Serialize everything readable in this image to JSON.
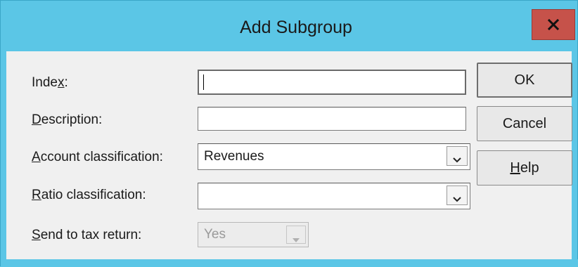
{
  "window": {
    "title": "Add Subgroup",
    "close_label": "x",
    "accent_color": "#5bc6e6",
    "close_color": "#c6524a"
  },
  "form": {
    "index": {
      "label_pre": "Inde",
      "label_key": "x",
      "label_post": ":",
      "value": ""
    },
    "description": {
      "label_pre": "",
      "label_key": "D",
      "label_post": "escription:",
      "value": ""
    },
    "account_classification": {
      "label_pre": "",
      "label_key": "A",
      "label_post": "ccount classification:",
      "value": "Revenues"
    },
    "ratio_classification": {
      "label_pre": "",
      "label_key": "R",
      "label_post": "atio classification:",
      "value": ""
    },
    "send_to_tax_return": {
      "label_pre": "",
      "label_key": "S",
      "label_post": "end to tax return:",
      "value": "Yes",
      "disabled": true
    }
  },
  "buttons": {
    "ok": "OK",
    "cancel": "Cancel",
    "help_key": "H",
    "help_rest": "elp"
  },
  "icons": {
    "dropdown": "chevron-down-icon",
    "close": "close-icon"
  }
}
